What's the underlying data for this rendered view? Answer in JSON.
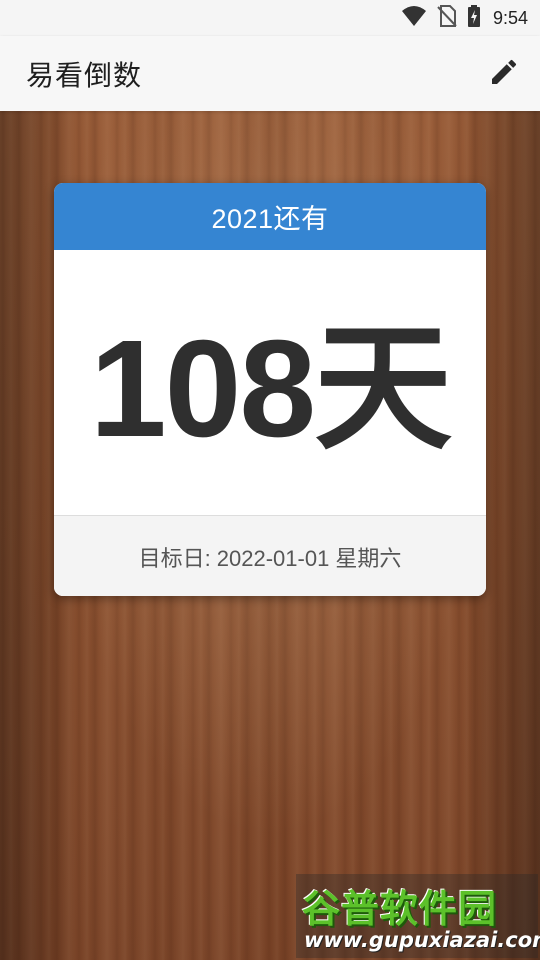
{
  "status_bar": {
    "time": "9:54",
    "icons": [
      "wifi-icon",
      "no-sim-icon",
      "battery-charging-icon"
    ]
  },
  "app_bar": {
    "title": "易看倒数",
    "action_icon": "edit-pencil-icon"
  },
  "card": {
    "header": "2021还有",
    "count": "108天",
    "target_label": "目标日: 2022-01-01 星期六",
    "header_color": "#3585d2"
  },
  "watermark": {
    "title": "谷普软件园",
    "url": "www.gupuxiazai.com"
  },
  "colors": {
    "accent": "#3585d2",
    "wood": "#8d5332"
  }
}
